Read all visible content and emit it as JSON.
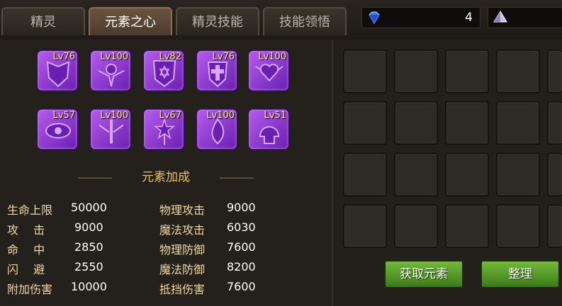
{
  "tabs": [
    {
      "label": "精灵"
    },
    {
      "label": "元素之心"
    },
    {
      "label": "精灵技能"
    },
    {
      "label": "技能领悟"
    }
  ],
  "currency": {
    "gems": "4",
    "gems_icon": "diamond-icon",
    "crystal_icon": "crystal-icon"
  },
  "elements": [
    {
      "level": "Lv76"
    },
    {
      "level": "Lv100"
    },
    {
      "level": "Lv82"
    },
    {
      "level": "Lv76"
    },
    {
      "level": "Lv100"
    },
    {
      "level": "Lv57"
    },
    {
      "level": "Lv100"
    },
    {
      "level": "Lv67"
    },
    {
      "level": "Lv100"
    },
    {
      "level": "Lv51"
    }
  ],
  "bonus": {
    "title": "元素加成",
    "left": [
      {
        "label": "生命上限",
        "value": "50000"
      },
      {
        "label": "攻　 击",
        "value": "9000"
      },
      {
        "label": "命　 中",
        "value": "2850"
      },
      {
        "label": "闪　 避",
        "value": "2550"
      },
      {
        "label": "附加伤害",
        "value": "10000"
      }
    ],
    "right": [
      {
        "label": "物理攻击",
        "value": "9000"
      },
      {
        "label": "魔法攻击",
        "value": "6030"
      },
      {
        "label": "物理防御",
        "value": "7600"
      },
      {
        "label": "魔法防御",
        "value": "8200"
      },
      {
        "label": "抵挡伤害",
        "value": "7600"
      }
    ]
  },
  "buttons": {
    "get_elements": "获取元素",
    "organize": "整理"
  },
  "colors": {
    "accent": "#f0c060",
    "element_purple": "#9b3fe0",
    "button_green": "#5aa02a"
  }
}
